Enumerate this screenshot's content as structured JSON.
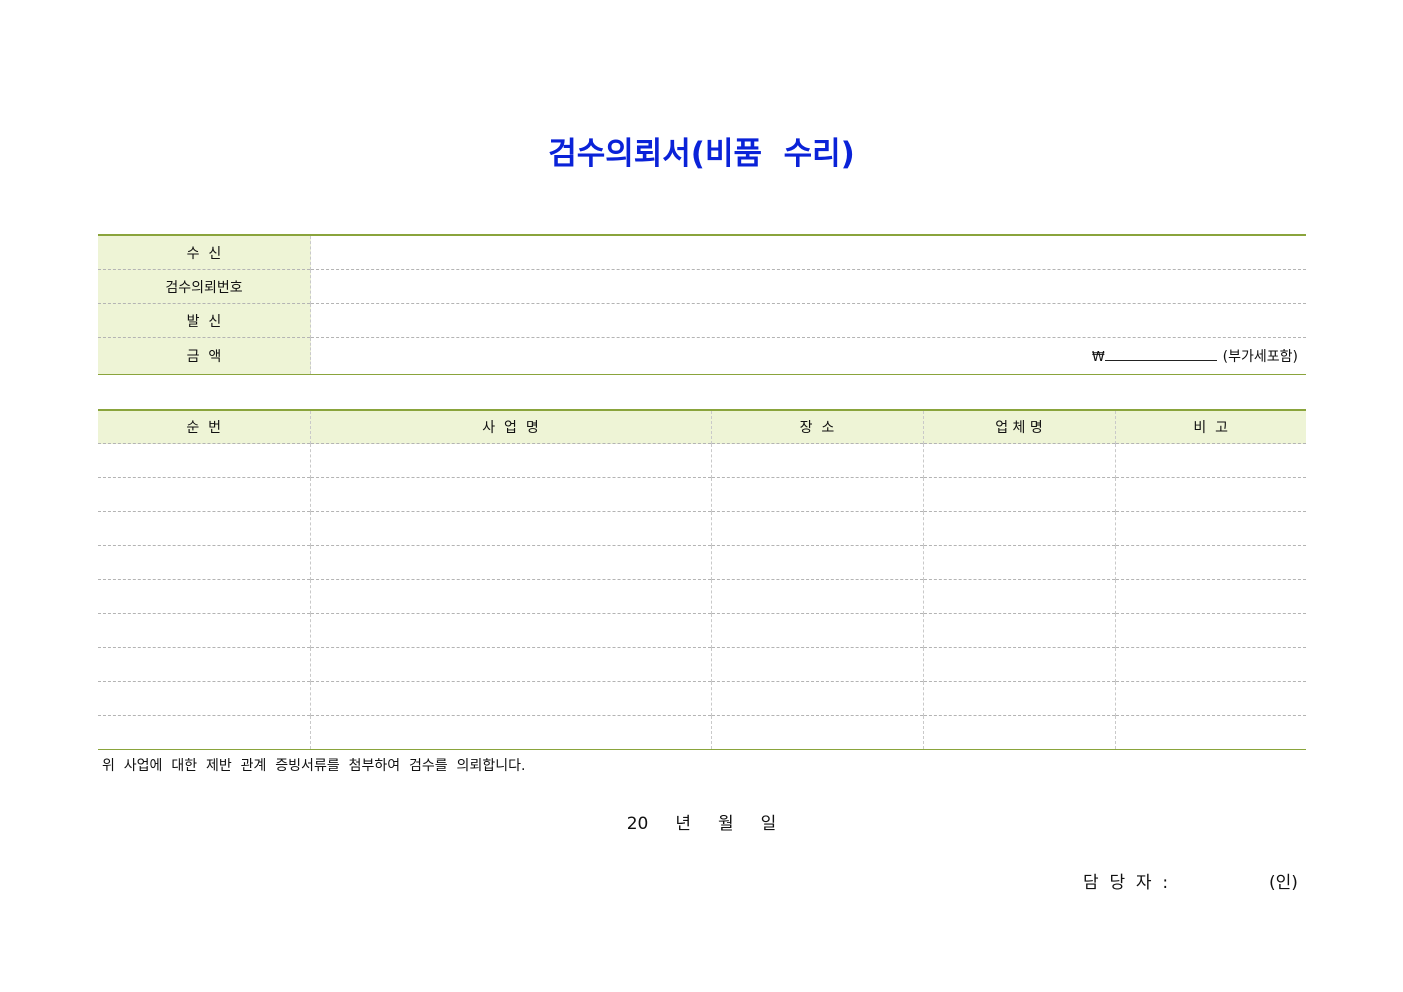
{
  "document": {
    "title": "검수의뢰서(비품  수리)"
  },
  "info": {
    "rows": [
      {
        "label": "수  신",
        "value": ""
      },
      {
        "label": "검수의뢰번호",
        "value": ""
      },
      {
        "label": "발  신",
        "value": ""
      },
      {
        "label": "금  액",
        "value": ""
      }
    ],
    "amount": {
      "currency_symbol": "₩",
      "vat_note": "(부가세포함)"
    }
  },
  "table": {
    "headers": [
      "순  번",
      "사  업  명",
      "장  소",
      "업 체 명",
      "비  고"
    ],
    "rows": [
      [
        "",
        "",
        "",
        "",
        ""
      ],
      [
        "",
        "",
        "",
        "",
        ""
      ],
      [
        "",
        "",
        "",
        "",
        ""
      ],
      [
        "",
        "",
        "",
        "",
        ""
      ],
      [
        "",
        "",
        "",
        "",
        ""
      ],
      [
        "",
        "",
        "",
        "",
        ""
      ],
      [
        "",
        "",
        "",
        "",
        ""
      ],
      [
        "",
        "",
        "",
        "",
        ""
      ],
      [
        "",
        "",
        "",
        "",
        ""
      ]
    ]
  },
  "footer": {
    "note": "위  사업에  대한  제반  관계  증빙서류를  첨부하여  검수를  의뢰합니다.",
    "date": "20     년     월     일",
    "signer_label": "담  당  자  :",
    "seal": "(인)"
  },
  "colors": {
    "title": "#0a22d8",
    "header_bg": "#eef4d6",
    "rule": "#8aa43c"
  }
}
